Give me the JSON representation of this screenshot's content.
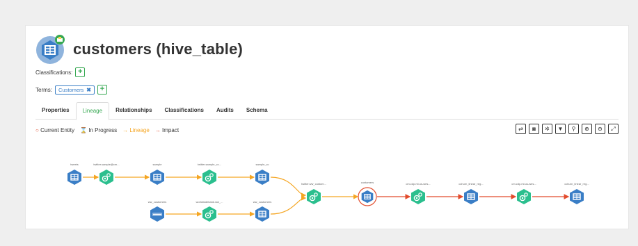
{
  "entity": {
    "name": "customers (hive_table)"
  },
  "classifications": {
    "label": "Classifications:",
    "add": "+"
  },
  "terms": {
    "label": "Terms:",
    "tag": "Customers",
    "remove": "✖",
    "add": "+"
  },
  "tabs": [
    "Properties",
    "Lineage",
    "Relationships",
    "Classifications",
    "Audits",
    "Schema"
  ],
  "active_tab": "Lineage",
  "legend": {
    "current": "Current Entity",
    "in_progress": "In Progress",
    "lineage": "Lineage",
    "impact": "Impact"
  },
  "toolbar": [
    "refresh-icon",
    "camera-icon",
    "settings-icon",
    "filter-icon",
    "search-icon",
    "zoom-in-icon",
    "zoom-out-icon",
    "fullscreen-icon"
  ],
  "colors": {
    "lineage": "#f5a623",
    "impact": "#e24b2c",
    "table_node": "#3a7ec6",
    "process_node": "#2bbf8e",
    "accent": "#36a852"
  },
  "nodes": {
    "tweets": "tweets",
    "twitter_sample_cm": "twitter.sample@cm...",
    "sample": "sample",
    "twitter_sample_cc": "twitter.sample_cc...",
    "sample_cc": "sample_cc",
    "ww_customers_src": "ww_customers",
    "worldwidebank": "worldwidebank.ww_...",
    "ww_customers": "ww_customers",
    "twitter_ww_custom": "twitter.ww_custom...",
    "customers": "customers",
    "cm_cdp_1": "cm.cdp.ml.us-wes...",
    "cchurn_1": "cchurn_linear_reg...",
    "cm_cdp_2": "cm.cdp.ml.us-wes...",
    "cchurn_2": "cchurn_linear_reg..."
  }
}
